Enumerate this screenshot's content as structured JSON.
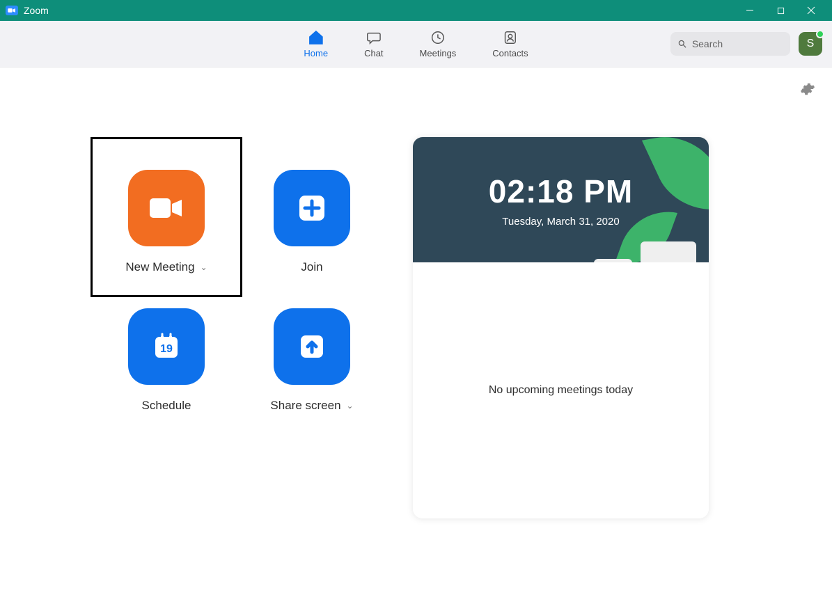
{
  "titlebar": {
    "app_name": "Zoom"
  },
  "nav": {
    "items": [
      {
        "label": "Home"
      },
      {
        "label": "Chat"
      },
      {
        "label": "Meetings"
      },
      {
        "label": "Contacts"
      }
    ]
  },
  "search": {
    "placeholder": "Search"
  },
  "avatar": {
    "initial": "S"
  },
  "actions": {
    "new_meeting": "New Meeting",
    "join": "Join",
    "schedule": "Schedule",
    "schedule_day": "19",
    "share_screen": "Share screen"
  },
  "panel": {
    "time": "02:18 PM",
    "date": "Tuesday, March 31, 2020",
    "upcoming": "No upcoming meetings today"
  }
}
